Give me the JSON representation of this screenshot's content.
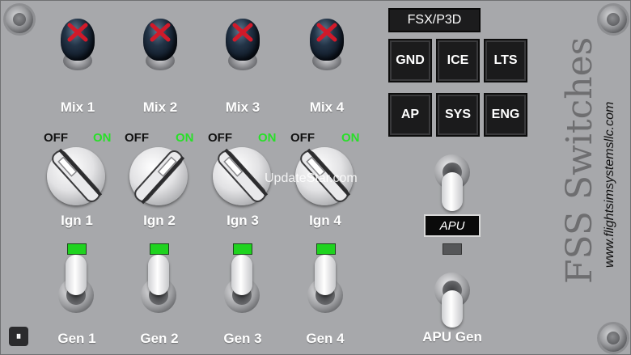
{
  "sim_selector": "FSX/P3D",
  "buttons": [
    {
      "label": "GND"
    },
    {
      "label": "ICE"
    },
    {
      "label": "LTS"
    },
    {
      "label": "AP"
    },
    {
      "label": "SYS"
    },
    {
      "label": "ENG"
    }
  ],
  "mixtures": [
    {
      "label": "Mix 1"
    },
    {
      "label": "Mix 2"
    },
    {
      "label": "Mix 3"
    },
    {
      "label": "Mix 4"
    }
  ],
  "ignition": {
    "off_label": "OFF",
    "on_label": "ON",
    "switches": [
      {
        "label": "Ign 1"
      },
      {
        "label": "Ign 2"
      },
      {
        "label": "Ign 3"
      },
      {
        "label": "Ign 4"
      }
    ]
  },
  "generators": [
    {
      "label": "Gen 1"
    },
    {
      "label": "Gen 2"
    },
    {
      "label": "Gen 3"
    },
    {
      "label": "Gen 4"
    }
  ],
  "apu": {
    "display": "APU",
    "gen_label": "APU Gen"
  },
  "brand": {
    "title": "FSS Switches",
    "url": "www.flightsimsystemsllc.com"
  },
  "watermark": "UpdateStar.com",
  "colors": {
    "panel": "#a7a8ab",
    "on_green": "#28e028",
    "lamp_green": "#1fd31f",
    "button_bg": "#1b1b1c"
  },
  "icons": [
    "screw-icon",
    "mixture-knob-icon",
    "rotary-switch-icon",
    "toggle-switch-icon",
    "app-corner-icon"
  ]
}
